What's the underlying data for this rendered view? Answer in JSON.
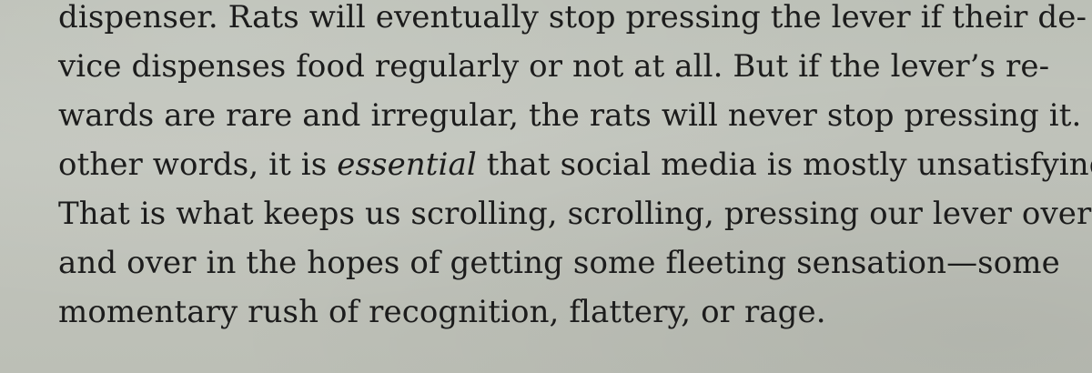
{
  "lines": [
    "dispenser. Rats will eventually stop pressing the lever if their de-",
    "vice dispenses food regularly or not at all. But if the lever’s re-",
    "wards are rare and irregular, the rats will never stop pressing it. In",
    {
      "before": "other words, it is ",
      "emphasis": "essential",
      "after": " that social media is mostly unsatisfying."
    },
    "That is what keeps us scrolling, scrolling, pressing our lever over",
    "and over in the hopes of getting some fleeting sensation—some",
    "momentary rush of recognition, flattery, or rage."
  ],
  "line4": {
    "before": "other words, it is ",
    "emphasis": "essential",
    "after": " that social media is mostly unsatisfying."
  },
  "text": {
    "l1": "dispenser. Rats will eventually stop pressing the lever if their de-",
    "l2": "vice dispenses food regularly or not at all. But if the lever’s re-",
    "l3": "wards are rare and irregular, the rats will never stop pressing it. In",
    "l5": "That is what keeps us scrolling, scrolling, pressing our lever over",
    "l6": "and over in the hopes of getting some fleeting sensation—some",
    "l7": "momentary rush of recognition, flattery, or rage."
  }
}
